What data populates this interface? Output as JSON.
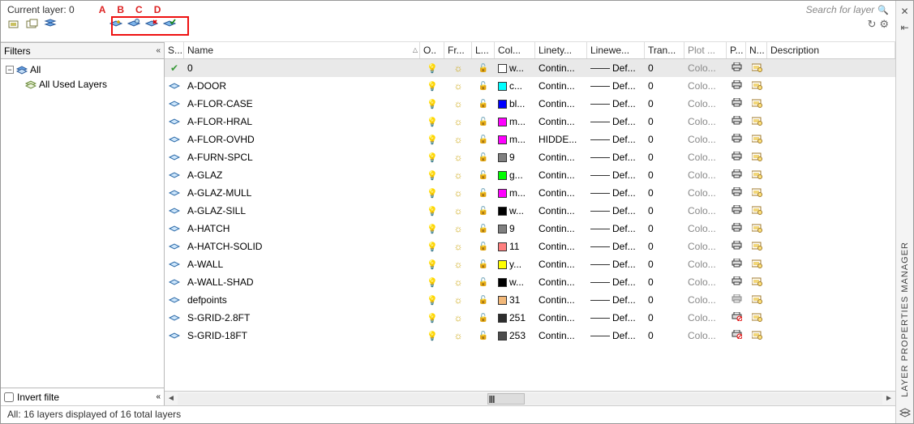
{
  "header": {
    "current_layer_label": "Current layer: 0",
    "annotations": [
      "A",
      "B",
      "C",
      "D"
    ],
    "search_placeholder": "Search for layer"
  },
  "filters": {
    "title": "Filters",
    "all": "All",
    "all_used": "All Used Layers",
    "invert": "Invert filte"
  },
  "columns": {
    "status": "S...",
    "name": "Name",
    "on": "O..",
    "freeze": "Fr...",
    "lock": "L...",
    "color": "Col...",
    "linetype": "Linety...",
    "lineweight": "Linewe...",
    "trans": "Tran...",
    "plotstyle": "Plot ...",
    "plot": "P...",
    "newvp": "N...",
    "desc": "Description"
  },
  "colors": {
    "white": "#ffffff",
    "cyan": "#00ffff",
    "blue": "#0000ff",
    "magenta": "#ff00ff",
    "green": "#00ff00",
    "yellow": "#ffff00",
    "black": "#000000",
    "c9": "#808080",
    "c11": "#ff7f7f",
    "c31": "#f2b879",
    "c251": "#2d2d2d",
    "c253": "#4d4d4d"
  },
  "layers": [
    {
      "status": "current",
      "name": "0",
      "color": "white",
      "color_label": "w...",
      "linetype": "Contin...",
      "lw": "Def...",
      "tr": "0",
      "ps": "Colo...",
      "plot": true,
      "nvp": true,
      "sel": true
    },
    {
      "status": "rh",
      "name": "A-DOOR",
      "color": "cyan",
      "color_label": "c...",
      "linetype": "Contin...",
      "lw": "Def...",
      "tr": "0",
      "ps": "Colo...",
      "plot": true,
      "nvp": true
    },
    {
      "status": "rh",
      "name": "A-FLOR-CASE",
      "color": "blue",
      "color_label": "bl...",
      "linetype": "Contin...",
      "lw": "Def...",
      "tr": "0",
      "ps": "Colo...",
      "plot": true,
      "nvp": true
    },
    {
      "status": "rh",
      "name": "A-FLOR-HRAL",
      "color": "magenta",
      "color_label": "m...",
      "linetype": "Contin...",
      "lw": "Def...",
      "tr": "0",
      "ps": "Colo...",
      "plot": true,
      "nvp": true
    },
    {
      "status": "rh",
      "name": "A-FLOR-OVHD",
      "color": "magenta",
      "color_label": "m...",
      "linetype": "HIDDE...",
      "lw": "Def...",
      "tr": "0",
      "ps": "Colo...",
      "plot": true,
      "nvp": true
    },
    {
      "status": "rh",
      "name": "A-FURN-SPCL",
      "color": "c9",
      "color_label": "9",
      "linetype": "Contin...",
      "lw": "Def...",
      "tr": "0",
      "ps": "Colo...",
      "plot": true,
      "nvp": true
    },
    {
      "status": "rh",
      "name": "A-GLAZ",
      "color": "green",
      "color_label": "g...",
      "linetype": "Contin...",
      "lw": "Def...",
      "tr": "0",
      "ps": "Colo...",
      "plot": true,
      "nvp": true
    },
    {
      "status": "rh",
      "name": "A-GLAZ-MULL",
      "color": "magenta",
      "color_label": "m...",
      "linetype": "Contin...",
      "lw": "Def...",
      "tr": "0",
      "ps": "Colo...",
      "plot": true,
      "nvp": true
    },
    {
      "status": "rh",
      "name": "A-GLAZ-SILL",
      "color": "black",
      "color_label": "w...",
      "linetype": "Contin...",
      "lw": "Def...",
      "tr": "0",
      "ps": "Colo...",
      "plot": true,
      "nvp": true
    },
    {
      "status": "rh",
      "name": "A-HATCH",
      "color": "c9",
      "color_label": "9",
      "linetype": "Contin...",
      "lw": "Def...",
      "tr": "0",
      "ps": "Colo...",
      "plot": true,
      "nvp": true
    },
    {
      "status": "rh",
      "name": "A-HATCH-SOLID",
      "color": "c11",
      "color_label": "11",
      "linetype": "Contin...",
      "lw": "Def...",
      "tr": "0",
      "ps": "Colo...",
      "plot": true,
      "nvp": true
    },
    {
      "status": "rh",
      "name": "A-WALL",
      "color": "yellow",
      "color_label": "y...",
      "linetype": "Contin...",
      "lw": "Def...",
      "tr": "0",
      "ps": "Colo...",
      "plot": true,
      "nvp": true
    },
    {
      "status": "rh",
      "name": "A-WALL-SHAD",
      "color": "black",
      "color_label": "w...",
      "linetype": "Contin...",
      "lw": "Def...",
      "tr": "0",
      "ps": "Colo...",
      "plot": true,
      "nvp": true
    },
    {
      "status": "rh",
      "name": "defpoints",
      "color": "c31",
      "color_label": "31",
      "linetype": "Contin...",
      "lw": "Def...",
      "tr": "0",
      "ps": "Colo...",
      "plot": false,
      "nvp": true
    },
    {
      "status": "rh",
      "name": "S-GRID-2.8FT",
      "color": "c251",
      "color_label": "251",
      "linetype": "Contin...",
      "lw": "Def...",
      "tr": "0",
      "ps": "Colo...",
      "plot": "no",
      "nvp": true
    },
    {
      "status": "rh",
      "name": "S-GRID-18FT",
      "color": "c253",
      "color_label": "253",
      "linetype": "Contin...",
      "lw": "Def...",
      "tr": "0",
      "ps": "Colo...",
      "plot": "no",
      "nvp": true
    }
  ],
  "status": "All: 16 layers displayed of 16 total layers",
  "panel_title": "LAYER PROPERTIES MANAGER"
}
